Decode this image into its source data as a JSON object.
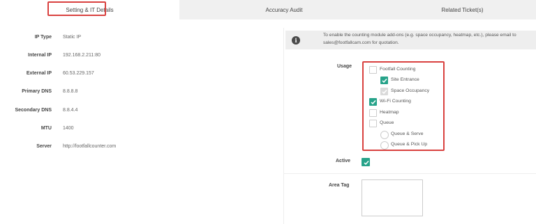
{
  "tabs": [
    {
      "label": "Setting & IT Details"
    },
    {
      "label": "Accuracy Audit"
    },
    {
      "label": "Related Ticket(s)"
    }
  ],
  "details": [
    {
      "label": "IP Type",
      "value": "Static IP"
    },
    {
      "label": "Internal IP",
      "value": "192.168.2.211:80"
    },
    {
      "label": "External IP",
      "value": "60.53.229.157"
    },
    {
      "label": "Primary DNS",
      "value": "8.8.8.8"
    },
    {
      "label": "Secondary DNS",
      "value": "8.8.4.4"
    },
    {
      "label": "MTU",
      "value": "1400"
    },
    {
      "label": "Server",
      "value": "http://footfallcounter.com"
    }
  ],
  "info": {
    "line1": "To enable the counting module add-ons (e.g. space occupancy, heatmap, etc.), please email to",
    "line2": "sales@footfallcam.com for quotation."
  },
  "usage": {
    "label": "Usage",
    "options": [
      {
        "label": "Footfall Counting",
        "state": "unchecked"
      },
      {
        "label": "Site Entrance",
        "state": "checked"
      },
      {
        "label": "Space Occupancy",
        "state": "checked-disabled"
      },
      {
        "label": "Wi-Fi Counting",
        "state": "checked"
      },
      {
        "label": "Heatmap",
        "state": "unchecked"
      },
      {
        "label": "Queue",
        "state": "unchecked"
      },
      {
        "label": "Queue & Serve",
        "state": "radio-off"
      },
      {
        "label": "Queue & Pick Up",
        "state": "radio-off"
      }
    ]
  },
  "active": {
    "label": "Active",
    "checked": true
  },
  "area_tag": {
    "label": "Area Tag",
    "value": ""
  },
  "colors": {
    "accent": "#27a38a",
    "highlight": "#d9413f"
  }
}
